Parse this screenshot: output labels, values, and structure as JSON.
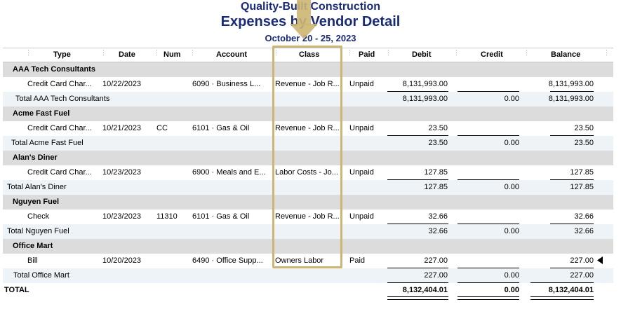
{
  "report": {
    "company": "Quality-Built Construction",
    "title": "Expenses by Vendor Detail",
    "date_range": "October 20 - 25, 2023"
  },
  "columns": [
    "Type",
    "Date",
    "Num",
    "Account",
    "Class",
    "Paid",
    "Debit",
    "Credit",
    "Balance"
  ],
  "groups": [
    {
      "vendor": "AAA Tech Consultants",
      "rows": [
        {
          "type": "Credit Card Char...",
          "date": "10/22/2023",
          "num": "",
          "account": "6090 · Business L...",
          "class": "Revenue - Job R...",
          "paid": "Unpaid",
          "debit": "8,131,993.00",
          "credit": "",
          "balance": "8,131,993.00"
        }
      ],
      "total_label": "Total AAA Tech Consultants",
      "total_debit": "8,131,993.00",
      "total_credit": "0.00",
      "total_balance": "8,131,993.00"
    },
    {
      "vendor": "Acme Fast Fuel",
      "rows": [
        {
          "type": "Credit Card Char...",
          "date": "10/21/2023",
          "num": "CC",
          "account": "6101 · Gas & Oil",
          "class": "Revenue - Job R...",
          "paid": "Unpaid",
          "debit": "23.50",
          "credit": "",
          "balance": "23.50"
        }
      ],
      "total_label": "Total Acme Fast Fuel",
      "total_debit": "23.50",
      "total_credit": "0.00",
      "total_balance": "23.50"
    },
    {
      "vendor": "Alan's Diner",
      "rows": [
        {
          "type": "Credit Card Char...",
          "date": "10/23/2023",
          "num": "",
          "account": "6900 · Meals and E...",
          "class": "Labor Costs - Jo...",
          "paid": "Unpaid",
          "debit": "127.85",
          "credit": "",
          "balance": "127.85"
        }
      ],
      "total_label": "Total Alan's Diner",
      "total_debit": "127.85",
      "total_credit": "0.00",
      "total_balance": "127.85"
    },
    {
      "vendor": "Nguyen Fuel",
      "rows": [
        {
          "type": "Check",
          "date": "10/23/2023",
          "num": "11310",
          "account": "6101 · Gas & Oil",
          "class": "Revenue - Job R...",
          "paid": "Unpaid",
          "debit": "32.66",
          "credit": "",
          "balance": "32.66"
        }
      ],
      "total_label": "Total Nguyen Fuel",
      "total_debit": "32.66",
      "total_credit": "0.00",
      "total_balance": "32.66"
    },
    {
      "vendor": "Office Mart",
      "rows": [
        {
          "type": "Bill",
          "date": "10/20/2023",
          "num": "",
          "account": "6490 · Office Supp...",
          "class": "Owners Labor",
          "paid": "Paid",
          "debit": "227.00",
          "credit": "",
          "balance": "227.00"
        }
      ],
      "total_label": "Total Office Mart",
      "total_debit": "227.00",
      "total_credit": "0.00",
      "total_balance": "227.00"
    }
  ],
  "grand_total": {
    "label": "TOTAL",
    "debit": "8,132,404.01",
    "credit": "0.00",
    "balance": "8,132,404.01"
  },
  "colors": {
    "header_text": "#1a2a7a",
    "group_bg": "#dcdcdc",
    "total_bg": "#eef3f8",
    "highlight": "#cdb673"
  },
  "icons": {
    "annotation_arrow": "down-arrow-icon",
    "row_pointer": "triangle-left-icon"
  }
}
